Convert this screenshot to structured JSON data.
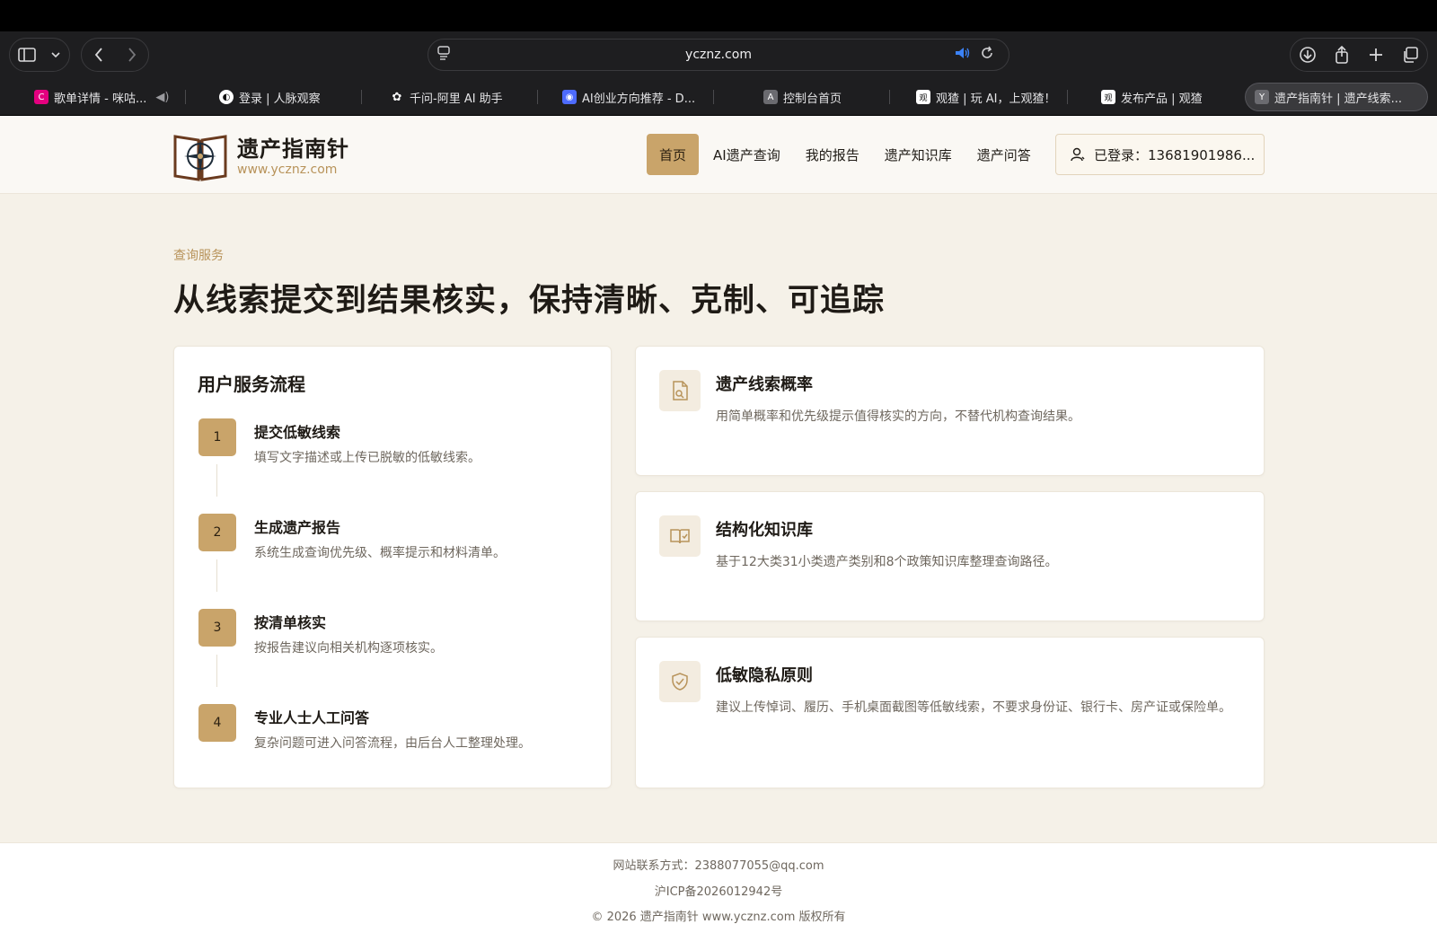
{
  "browser": {
    "address": "ycznz.com",
    "tabs": [
      {
        "label": "歌单详情 - 咪咕...",
        "fav": "C",
        "fav_color": "#e4007f"
      },
      {
        "label": "登录 | 人脉观察",
        "fav": "◐",
        "fav_color": "#111111"
      },
      {
        "label": "千问-阿里 AI 助手",
        "fav": "✿",
        "fav_color": "#1e1e20"
      },
      {
        "label": "AI创业方向推荐 - D...",
        "fav": "◉",
        "fav_color": "#4d6bfe"
      },
      {
        "label": "控制台首页",
        "fav": "A",
        "fav_color": "#6b6b70"
      },
      {
        "label": "观猹 | 玩 AI，上观猹！",
        "fav": "观",
        "fav_color": "#ffffff"
      },
      {
        "label": "发布产品 | 观猹",
        "fav": "观",
        "fav_color": "#ffffff"
      },
      {
        "label": "遗产指南针 | 遗产线索...",
        "fav": "Y",
        "fav_color": "#6b6b70"
      }
    ]
  },
  "site": {
    "brand_title": "遗产指南针",
    "brand_url": "www.ycznz.com",
    "nav": [
      "首页",
      "AI遗产查询",
      "我的报告",
      "遗产知识库",
      "遗产问答"
    ],
    "login_label": "已登录：13681901986..."
  },
  "main": {
    "eyebrow": "查询服务",
    "headline": "从线索提交到结果核实，保持清晰、克制、可追踪",
    "flow": {
      "title": "用户服务流程",
      "steps": [
        {
          "num": "1",
          "title": "提交低敏线索",
          "desc": "填写文字描述或上传已脱敏的低敏线索。"
        },
        {
          "num": "2",
          "title": "生成遗产报告",
          "desc": "系统生成查询优先级、概率提示和材料清单。"
        },
        {
          "num": "3",
          "title": "按清单核实",
          "desc": "按报告建议向相关机构逐项核实。"
        },
        {
          "num": "4",
          "title": "专业人士人工问答",
          "desc": "复杂问题可进入问答流程，由后台人工整理处理。"
        }
      ]
    },
    "features": [
      {
        "icon": "document-icon",
        "title": "遗产线索概率",
        "desc": "用简单概率和优先级提示值得核实的方向，不替代机构查询结果。"
      },
      {
        "icon": "book-icon",
        "title": "结构化知识库",
        "desc": "基于12大类31小类遗产类别和8个政策知识库整理查询路径。"
      },
      {
        "icon": "shield-icon",
        "title": "低敏隐私原则",
        "desc": "建议上传悼词、履历、手机桌面截图等低敏线索，不要求身份证、银行卡、房产证或保险单。"
      }
    ]
  },
  "footer": {
    "contact": "网站联系方式：2388077055@qq.com",
    "icp": "沪ICP备2026012942号",
    "copyright": "© 2026 遗产指南针 www.ycznz.com 版权所有"
  },
  "colors": {
    "accent": "#c9a46a",
    "accent_text": "#b8935a",
    "page_bg": "#f5f1e8"
  }
}
